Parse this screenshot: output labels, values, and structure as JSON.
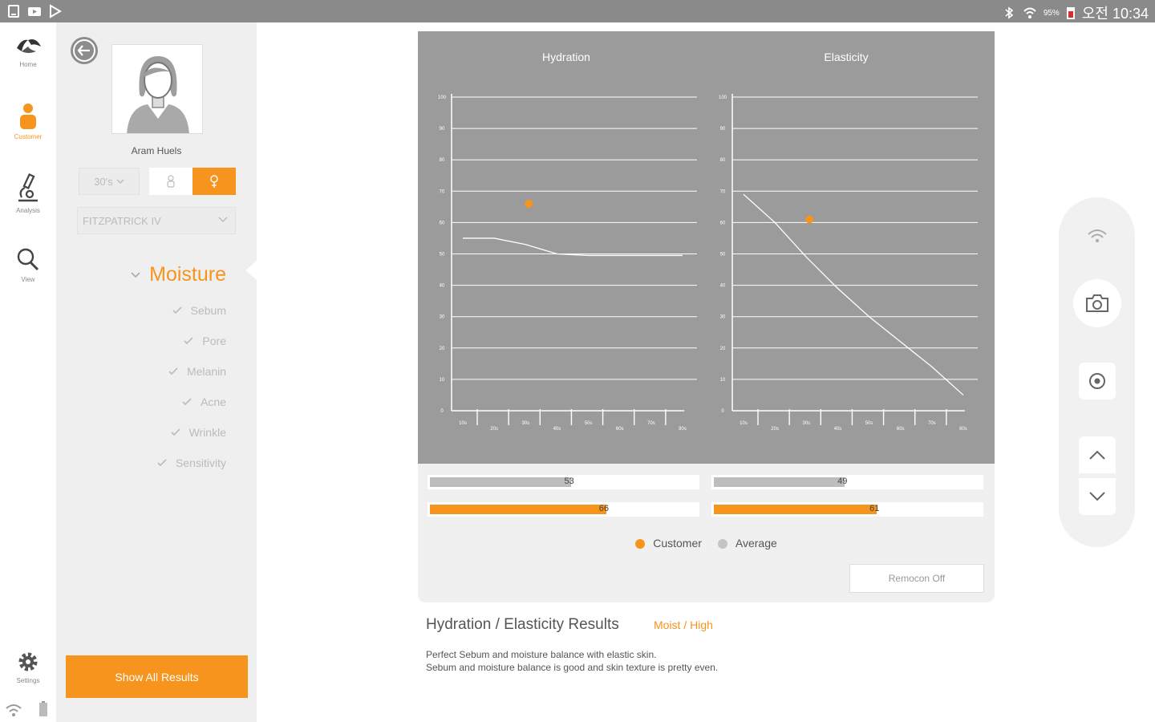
{
  "status_bar": {
    "battery": "95%",
    "time": "오전 10:34"
  },
  "nav": {
    "items": [
      {
        "label": "Home"
      },
      {
        "label": "Customer"
      },
      {
        "label": "Analysis"
      },
      {
        "label": "View"
      }
    ],
    "settings_label": "Settings"
  },
  "customer": {
    "name": "Aram Huels",
    "age_group": "30's",
    "skin_type": "FITZPATRICK IV"
  },
  "categories": {
    "active": "Moisture",
    "items": [
      "Sebum",
      "Pore",
      "Melanin",
      "Acne",
      "Wrinkle",
      "Sensitivity"
    ]
  },
  "show_all_label": "Show All Results",
  "chart_data": [
    {
      "type": "line",
      "title": "Hydration",
      "ylim": [
        0,
        100
      ],
      "y_ticks": [
        0,
        10,
        20,
        30,
        40,
        50,
        60,
        70,
        80,
        90,
        100
      ],
      "x": [
        "10s",
        "20s",
        "30s",
        "40s",
        "50s",
        "60s",
        "70s",
        "80s"
      ],
      "series": [
        {
          "values": [
            55,
            55,
            53,
            50,
            49.5,
            49.5,
            49.5,
            49.5
          ]
        }
      ],
      "customer_point": {
        "x": "30s",
        "y": 66
      },
      "grid": true
    },
    {
      "type": "line",
      "title": "Elasticity",
      "ylim": [
        0,
        100
      ],
      "y_ticks": [
        0,
        10,
        20,
        30,
        40,
        50,
        60,
        70,
        80,
        90,
        100
      ],
      "x": [
        "10s",
        "20s",
        "30s",
        "40s",
        "50s",
        "60s",
        "70s",
        "80s"
      ],
      "series": [
        {
          "values": [
            69,
            60,
            49,
            39,
            30,
            22,
            14,
            5
          ]
        }
      ],
      "customer_point": {
        "x": "30s",
        "y": 61
      },
      "grid": true
    }
  ],
  "bars": {
    "hydration": {
      "average": 53,
      "customer": 66
    },
    "elasticity": {
      "average": 49,
      "customer": 61
    }
  },
  "legend": {
    "customer": "Customer",
    "average": "Average"
  },
  "remocon_label": "Remocon Off",
  "result": {
    "title": "Hydration / Elasticity Results",
    "tag": "Moist / High",
    "line1": "Perfect Sebum and moisture balance with elastic skin.",
    "line2": "Sebum and moisture balance is good and skin texture is pretty even."
  },
  "colors": {
    "accent": "#f7941d",
    "chart_bg": "#9b9b9b",
    "panel_bg": "#efefef"
  }
}
